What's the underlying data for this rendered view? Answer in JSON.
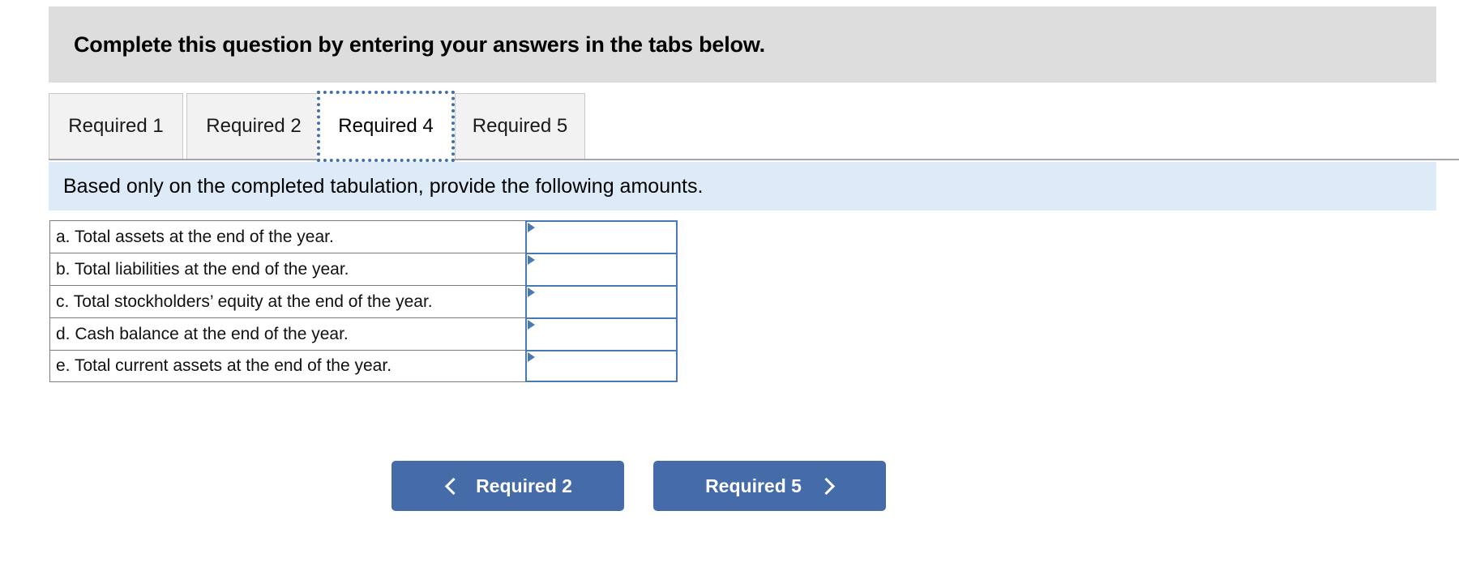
{
  "header": {
    "title": "Complete this question by entering your answers in the tabs below."
  },
  "tabs": {
    "items": [
      {
        "label": "Required 1",
        "active": false
      },
      {
        "label": "Required 2",
        "active": false
      },
      {
        "label": "Required 4",
        "active": true
      },
      {
        "label": "Required 5",
        "active": false
      }
    ],
    "active_index": 2
  },
  "instruction": {
    "text": "Based only on the completed tabulation, provide the following amounts."
  },
  "answers": {
    "rows": [
      {
        "label": "a. Total assets at the end of the year.",
        "value": "",
        "marker": "cell-marker-triangle"
      },
      {
        "label": "b. Total liabilities at the end of the year.",
        "value": "",
        "marker": "cell-marker-triangle"
      },
      {
        "label": "c. Total stockholders’ equity at the end of the year.",
        "value": "",
        "marker": "cell-marker-triangle"
      },
      {
        "label": "d. Cash balance at the end of the year.",
        "value": "",
        "marker": "cell-marker-triangle"
      },
      {
        "label": "e. Total current assets at the end of the year.",
        "value": "",
        "marker": "cell-marker-triangle"
      }
    ]
  },
  "nav": {
    "prev_label": "Required 2",
    "next_label": "Required 5",
    "prev_icon": "chevron-left-icon",
    "next_icon": "chevron-right-icon"
  },
  "colors": {
    "header_band": "#dddddd",
    "instruction_band": "#dcebf7",
    "button": "#456ba8",
    "active_tab_focus": "#4472a8",
    "cell_border": "#4a7ab5",
    "table_border": "#7b7b7b"
  }
}
